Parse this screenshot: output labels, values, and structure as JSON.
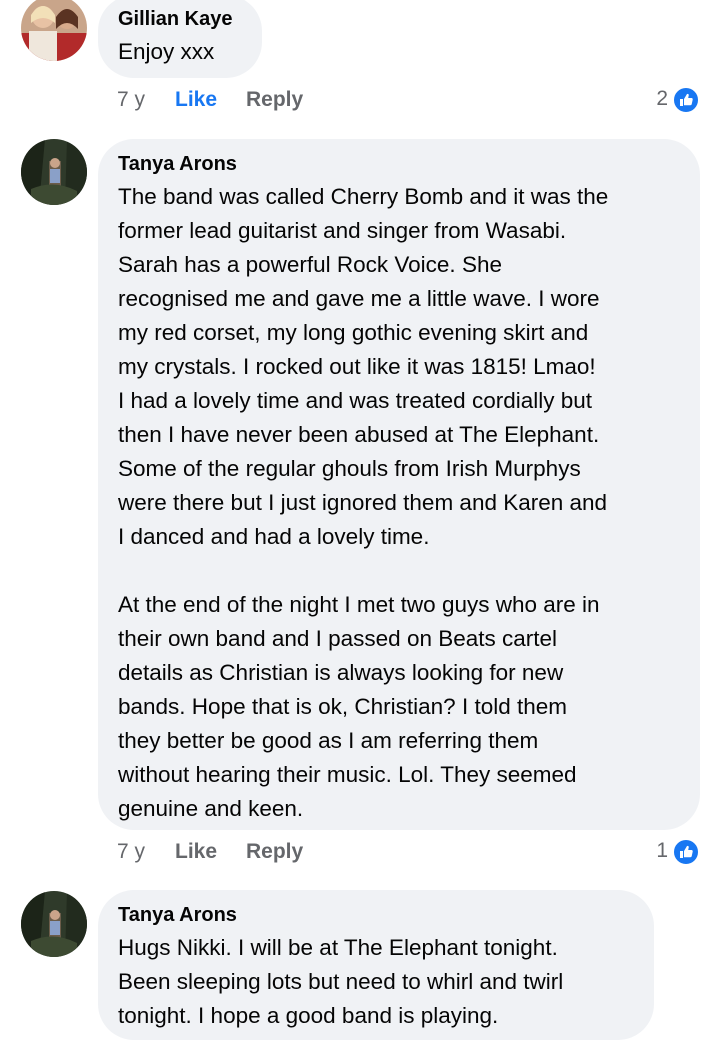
{
  "comments": [
    {
      "author": "Gillian Kaye",
      "lines": [
        "Enjoy xxx"
      ],
      "time": "7 y",
      "like_label": "Like",
      "reply_label": "Reply",
      "reaction_count": "2",
      "liked": true
    },
    {
      "author": "Tanya Arons",
      "lines": [
        "The band was called Cherry Bomb and it was the",
        "former lead guitarist and singer from Wasabi.",
        "Sarah has a powerful Rock Voice.  She",
        "recognised me and gave me a little wave.  I wore",
        "my red corset, my long gothic evening skirt and",
        "my crystals.  I rocked out like it was 1815!  Lmao!",
        "I had a lovely time and was treated cordially but",
        "then I have never been abused at The Elephant.",
        "Some of the regular ghouls from Irish Murphys",
        "were there but I just ignored them and Karen and",
        "I danced and had a lovely time.",
        "",
        "At the end of the night I met two guys who are in",
        "their own band and I passed on Beats cartel",
        "details as Christian is always looking for new",
        "bands.  Hope that is ok, Christian?  I told them",
        "they better be good as I am referring them",
        "without hearing their music.  Lol.  They seemed",
        "genuine and keen."
      ],
      "time": "7 y",
      "like_label": "Like",
      "reply_label": "Reply",
      "reaction_count": "1",
      "liked": false
    },
    {
      "author": "Tanya Arons",
      "lines": [
        "Hugs Nikki.  I will be at The Elephant tonight.",
        "Been sleeping lots but need to whirl and twirl",
        "tonight.  I hope a good band is playing."
      ],
      "time": "",
      "like_label": "",
      "reply_label": "",
      "reaction_count": "",
      "liked": false
    }
  ],
  "colors": {
    "bubble": "#f0f2f5",
    "meta_text": "#65676b",
    "accent_blue": "#1877f2"
  },
  "icons": {
    "reaction": "thumbs-up-icon"
  }
}
